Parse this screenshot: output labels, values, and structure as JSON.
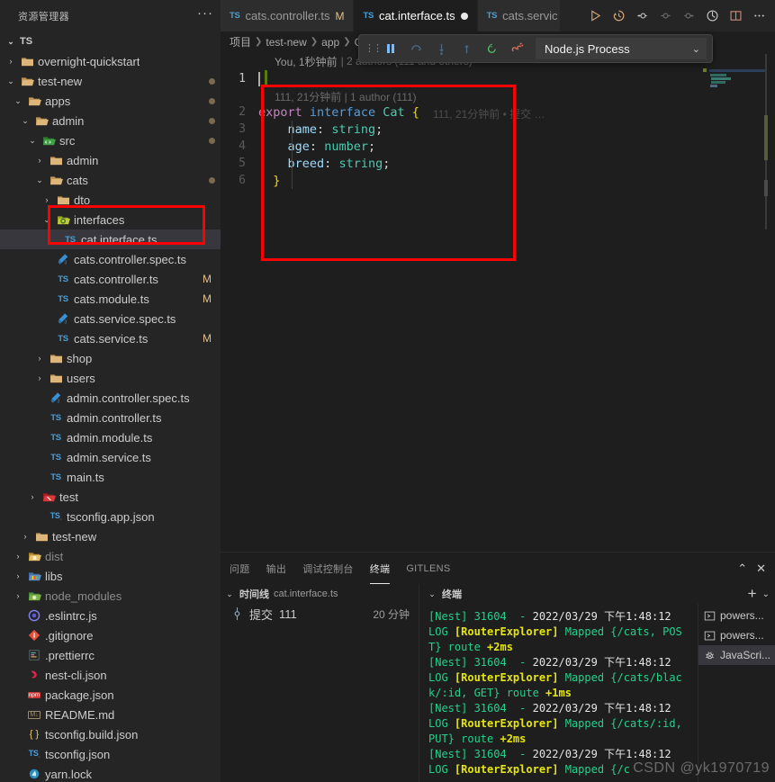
{
  "sidebar": {
    "title": "资源管理器",
    "more_label": "···",
    "section": {
      "label": "TS",
      "chevron": "⌄"
    },
    "tree": [
      {
        "depth": 1,
        "chev": "›",
        "icon": "folder",
        "label": "overnight-quickstart",
        "badge": ""
      },
      {
        "depth": 1,
        "chev": "⌄",
        "icon": "folder-open",
        "label": "test-new",
        "badge": "dot"
      },
      {
        "depth": 2,
        "chev": "⌄",
        "icon": "folder-open",
        "label": "apps",
        "badge": "dot"
      },
      {
        "depth": 3,
        "chev": "⌄",
        "icon": "folder-open",
        "label": "admin",
        "badge": "dot"
      },
      {
        "depth": 4,
        "chev": "⌄",
        "icon": "folder-src",
        "label": "src",
        "badge": "dot"
      },
      {
        "depth": 5,
        "chev": "›",
        "icon": "folder",
        "label": "admin",
        "badge": ""
      },
      {
        "depth": 5,
        "chev": "⌄",
        "icon": "folder-open",
        "label": "cats",
        "badge": "dot"
      },
      {
        "depth": 6,
        "chev": "›",
        "icon": "folder",
        "label": "dto",
        "badge": ""
      },
      {
        "depth": 6,
        "chev": "⌄",
        "icon": "folder-interfaces",
        "label": "interfaces",
        "badge": ""
      },
      {
        "depth": 7,
        "chev": "",
        "icon": "ts",
        "label": "cat.interface.ts",
        "badge": "",
        "selected": true
      },
      {
        "depth": 6,
        "chev": "",
        "icon": "test",
        "label": "cats.controller.spec.ts",
        "badge": ""
      },
      {
        "depth": 6,
        "chev": "",
        "icon": "ts",
        "label": "cats.controller.ts",
        "badge": "M"
      },
      {
        "depth": 6,
        "chev": "",
        "icon": "ts",
        "label": "cats.module.ts",
        "badge": "M"
      },
      {
        "depth": 6,
        "chev": "",
        "icon": "test",
        "label": "cats.service.spec.ts",
        "badge": ""
      },
      {
        "depth": 6,
        "chev": "",
        "icon": "ts",
        "label": "cats.service.ts",
        "badge": "M"
      },
      {
        "depth": 5,
        "chev": "›",
        "icon": "folder",
        "label": "shop",
        "badge": ""
      },
      {
        "depth": 5,
        "chev": "›",
        "icon": "folder",
        "label": "users",
        "badge": ""
      },
      {
        "depth": 5,
        "chev": "",
        "icon": "test",
        "label": "admin.controller.spec.ts",
        "badge": ""
      },
      {
        "depth": 5,
        "chev": "",
        "icon": "ts",
        "label": "admin.controller.ts",
        "badge": ""
      },
      {
        "depth": 5,
        "chev": "",
        "icon": "ts",
        "label": "admin.module.ts",
        "badge": ""
      },
      {
        "depth": 5,
        "chev": "",
        "icon": "ts",
        "label": "admin.service.ts",
        "badge": ""
      },
      {
        "depth": 5,
        "chev": "",
        "icon": "ts",
        "label": "main.ts",
        "badge": ""
      },
      {
        "depth": 4,
        "chev": "›",
        "icon": "folder-test",
        "label": "test",
        "badge": ""
      },
      {
        "depth": 5,
        "chev": "",
        "icon": "tsconfig",
        "label": "tsconfig.app.json",
        "badge": ""
      },
      {
        "depth": 3,
        "chev": "›",
        "icon": "folder",
        "label": "test-new",
        "badge": ""
      },
      {
        "depth": 2,
        "chev": "›",
        "icon": "folder-dist",
        "label": "dist",
        "badge": "",
        "dim": true
      },
      {
        "depth": 2,
        "chev": "›",
        "icon": "folder-libs",
        "label": "libs",
        "badge": ""
      },
      {
        "depth": 2,
        "chev": "›",
        "icon": "folder-node",
        "label": "node_modules",
        "badge": "",
        "dim": true
      },
      {
        "depth": 2,
        "chev": "",
        "icon": "eslint",
        "label": ".eslintrc.js",
        "badge": ""
      },
      {
        "depth": 2,
        "chev": "",
        "icon": "git",
        "label": ".gitignore",
        "badge": ""
      },
      {
        "depth": 2,
        "chev": "",
        "icon": "prettier",
        "label": ".prettierrc",
        "badge": ""
      },
      {
        "depth": 2,
        "chev": "",
        "icon": "nest",
        "label": "nest-cli.json",
        "badge": ""
      },
      {
        "depth": 2,
        "chev": "",
        "icon": "npm",
        "label": "package.json",
        "badge": ""
      },
      {
        "depth": 2,
        "chev": "",
        "icon": "md",
        "label": "README.md",
        "badge": ""
      },
      {
        "depth": 2,
        "chev": "",
        "icon": "json",
        "label": "tsconfig.build.json",
        "badge": ""
      },
      {
        "depth": 2,
        "chev": "",
        "icon": "tsconfig",
        "label": "tsconfig.json",
        "badge": ""
      },
      {
        "depth": 2,
        "chev": "",
        "icon": "yarn",
        "label": "yarn.lock",
        "badge": ""
      }
    ]
  },
  "editor": {
    "tabs": [
      {
        "prefix": "TS",
        "label": "cats.controller.ts",
        "suffix": "M",
        "active": false,
        "dirty": false
      },
      {
        "prefix": "TS",
        "label": "cat.interface.ts",
        "suffix": "",
        "active": true,
        "dirty": true
      },
      {
        "prefix": "TS",
        "label": "cats.servic",
        "suffix": "",
        "active": false,
        "dirty": false,
        "clipped": true
      }
    ],
    "actions": [
      "run-icon",
      "history-icon",
      "diff-prev-icon",
      "diff-cur-icon",
      "diff-next-icon",
      "blame-icon",
      "split-editor-icon",
      "more-actions-icon"
    ],
    "breadcrumb": [
      "项目",
      "test-new",
      "app",
      "Cat"
    ],
    "blame_top": {
      "author": "You, 1秒钟前",
      "rest": "| 2 authors (111 and others)"
    },
    "codelens": "111, 21分钟前 | 1 author (111)",
    "inline_blame": "111,  21分钟前  •  提交  …",
    "lines": [
      {
        "n": "1",
        "tokens": [],
        "current": true,
        "cursor": true,
        "gutterAdd": true
      },
      {
        "n": "2",
        "tokens": [
          {
            "t": "export",
            "c": "k-purple"
          },
          {
            "t": " ",
            "c": "k-plain"
          },
          {
            "t": "interface",
            "c": "k-blue"
          },
          {
            "t": " ",
            "c": "k-plain"
          },
          {
            "t": "Cat",
            "c": "k-teal"
          },
          {
            "t": " ",
            "c": "k-plain"
          },
          {
            "t": "{",
            "c": "k-yellow"
          }
        ]
      },
      {
        "n": "3",
        "tokens": [
          {
            "t": "    ",
            "c": "k-plain"
          },
          {
            "t": "name",
            "c": "k-light"
          },
          {
            "t": ":",
            "c": "k-plain"
          },
          {
            "t": " ",
            "c": "k-plain"
          },
          {
            "t": "string",
            "c": "k-teal"
          },
          {
            "t": ";",
            "c": "k-plain"
          }
        ]
      },
      {
        "n": "4",
        "tokens": [
          {
            "t": "    ",
            "c": "k-plain"
          },
          {
            "t": "age",
            "c": "k-light"
          },
          {
            "t": ":",
            "c": "k-plain"
          },
          {
            "t": " ",
            "c": "k-plain"
          },
          {
            "t": "number",
            "c": "k-teal"
          },
          {
            "t": ";",
            "c": "k-plain"
          }
        ]
      },
      {
        "n": "5",
        "tokens": [
          {
            "t": "    ",
            "c": "k-plain"
          },
          {
            "t": "breed",
            "c": "k-light"
          },
          {
            "t": ":",
            "c": "k-plain"
          },
          {
            "t": " ",
            "c": "k-plain"
          },
          {
            "t": "string",
            "c": "k-teal"
          },
          {
            "t": ";",
            "c": "k-plain"
          }
        ]
      },
      {
        "n": "6",
        "tokens": [
          {
            "t": "  ",
            "c": "k-plain"
          },
          {
            "t": "}",
            "c": "k-yellow"
          }
        ]
      }
    ]
  },
  "debug_toolbar": {
    "grip": "⠿",
    "buttons": [
      "pause-icon",
      "step-over-icon",
      "step-into-icon",
      "step-out-icon",
      "restart-icon",
      "disconnect-icon"
    ],
    "session": "Node.js Process",
    "chevron": "⌄"
  },
  "panel": {
    "tabs": [
      {
        "label": "问题",
        "active": false
      },
      {
        "label": "输出",
        "active": false
      },
      {
        "label": "调试控制台",
        "active": false
      },
      {
        "label": "终端",
        "active": true
      },
      {
        "label": "GITLENS",
        "active": false
      }
    ],
    "actions": {
      "collapse": "⌃",
      "close": "✕"
    },
    "timeline": {
      "chevron": "⌄",
      "title": "时间线",
      "file": "cat.interface.ts",
      "rows": [
        {
          "icon": "commit-icon",
          "label": "提交",
          "detail": "111",
          "when": "20 分钟"
        }
      ]
    },
    "terminal": {
      "chevron": "⌄",
      "title": "终端",
      "add": "+",
      "split": "⌄",
      "output": [
        {
          "segs": [
            {
              "t": "[Nest] 31604  - ",
              "c": "t-green"
            },
            {
              "t": "2022/03/29 下午1:48:12",
              "c": "t-white"
            },
            {
              "t": "     LOG ",
              "c": "t-green"
            },
            {
              "t": "[RouterExplorer] ",
              "c": "t-yellow"
            },
            {
              "t": "Mapped {/cats, POST} route ",
              "c": "t-green"
            },
            {
              "t": "+2ms",
              "c": "t-yellow"
            }
          ]
        },
        {
          "segs": [
            {
              "t": "[Nest] 31604  - ",
              "c": "t-green"
            },
            {
              "t": "2022/03/29 下午1:48:12",
              "c": "t-white"
            },
            {
              "t": "     LOG ",
              "c": "t-green"
            },
            {
              "t": "[RouterExplorer] ",
              "c": "t-yellow"
            },
            {
              "t": "Mapped {/cats/black/:id, GET} route ",
              "c": "t-green"
            },
            {
              "t": "+1ms",
              "c": "t-yellow"
            }
          ]
        },
        {
          "segs": [
            {
              "t": "[Nest] 31604  - ",
              "c": "t-green"
            },
            {
              "t": "2022/03/29 下午1:48:12",
              "c": "t-white"
            },
            {
              "t": "     LOG ",
              "c": "t-green"
            },
            {
              "t": "[RouterExplorer] ",
              "c": "t-yellow"
            },
            {
              "t": "Mapped {/cats/:id, PUT} route ",
              "c": "t-green"
            },
            {
              "t": "+2ms",
              "c": "t-yellow"
            }
          ]
        },
        {
          "segs": [
            {
              "t": "[Nest] 31604  - ",
              "c": "t-green"
            },
            {
              "t": "2022/03/29 下午1:48:12",
              "c": "t-white"
            },
            {
              "t": "     LOG ",
              "c": "t-green"
            },
            {
              "t": "[RouterExplorer] ",
              "c": "t-yellow"
            },
            {
              "t": "Mapped {/c",
              "c": "t-green"
            }
          ]
        }
      ],
      "list": [
        {
          "icon": "powershell-icon",
          "label": "powers...",
          "selected": false
        },
        {
          "icon": "powershell-icon",
          "label": "powers...",
          "selected": false
        },
        {
          "icon": "debug-icon",
          "label": "JavaScri...",
          "selected": true
        }
      ]
    }
  },
  "watermark": "CSDN @yk1970719",
  "colors": {
    "accent": "#0e639c",
    "sidebar_bg": "#252526",
    "editor_bg": "#1e1e1e",
    "highlight": "#fe0000",
    "modified": "#e2c08d",
    "selection": "#37373d"
  }
}
